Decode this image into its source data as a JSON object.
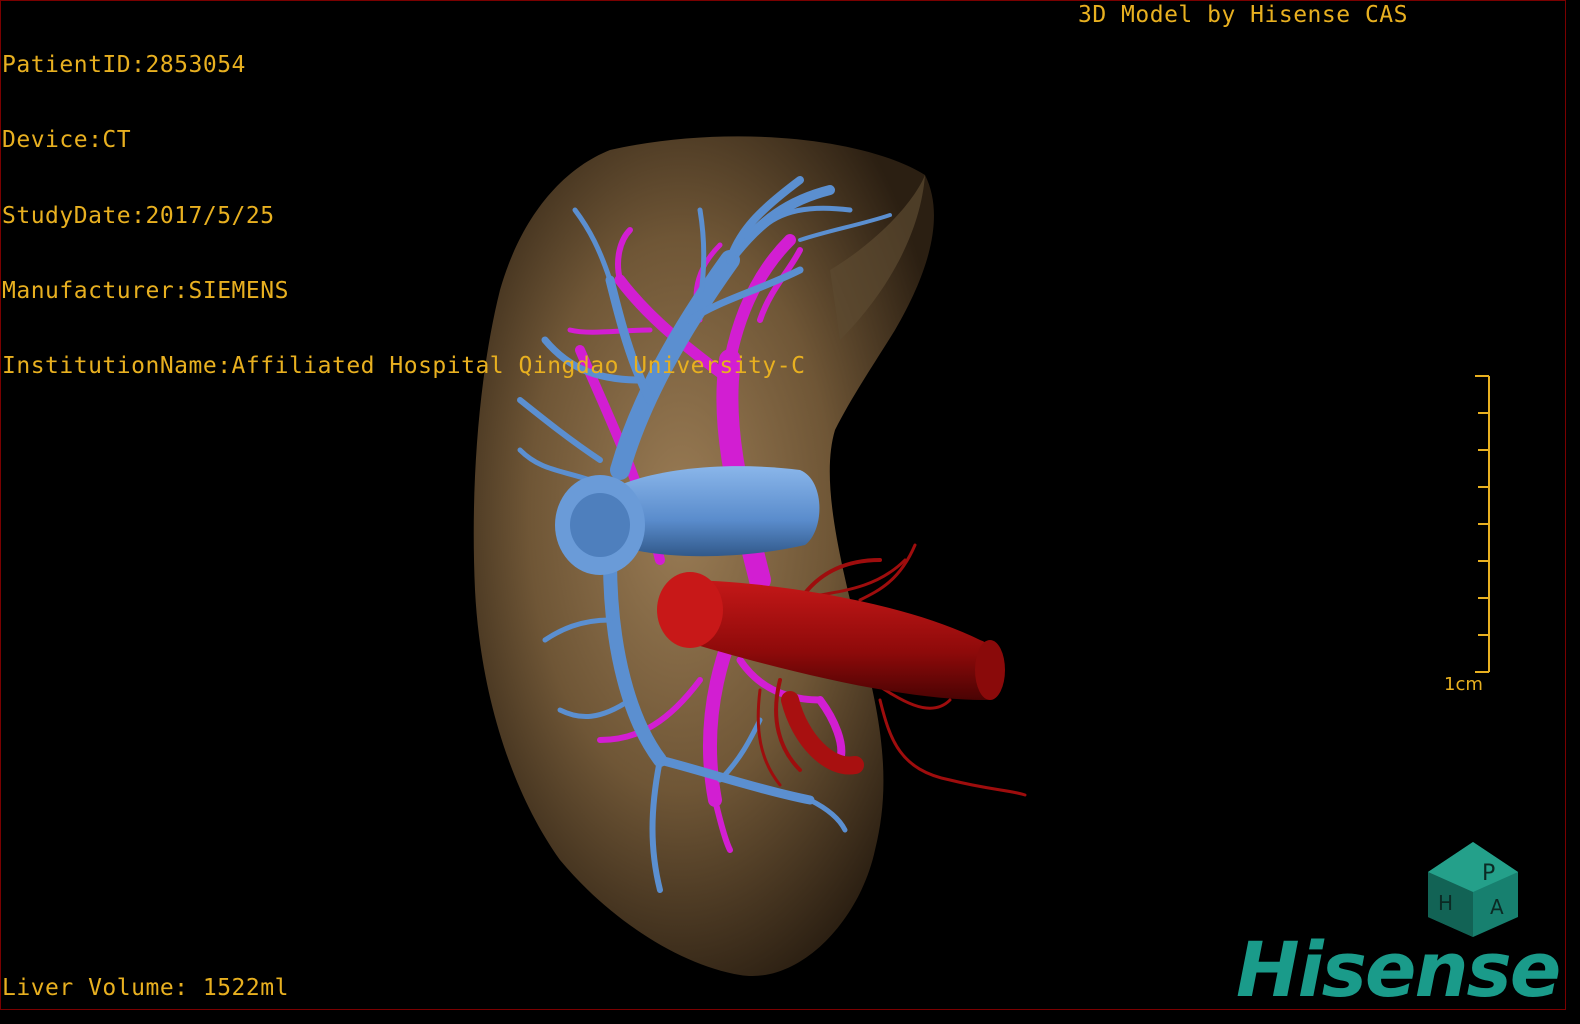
{
  "info": {
    "patient_id": "PatientID:2853054",
    "device": "Device:CT",
    "study_date": "StudyDate:2017/5/25",
    "manufacturer": "Manufacturer:SIEMENS",
    "institution": "InstitutionName:Affiliated Hospital Qingdao University-C"
  },
  "credit": "3D Model by Hisense CAS",
  "volume": "Liver Volume: 1522ml",
  "scale_bar": {
    "label": "1cm"
  },
  "orientation_cube": {
    "face_letters": [
      "P",
      "H",
      "A"
    ]
  },
  "brand": {
    "name": "Hisense",
    "color": "#1a9b8a"
  },
  "colors": {
    "text": "#e8b020",
    "liver": "#7a6040",
    "hepatic_vein": "#5b8fd0",
    "portal_vein": "#d21ed2",
    "artery": "#a80c0c"
  }
}
